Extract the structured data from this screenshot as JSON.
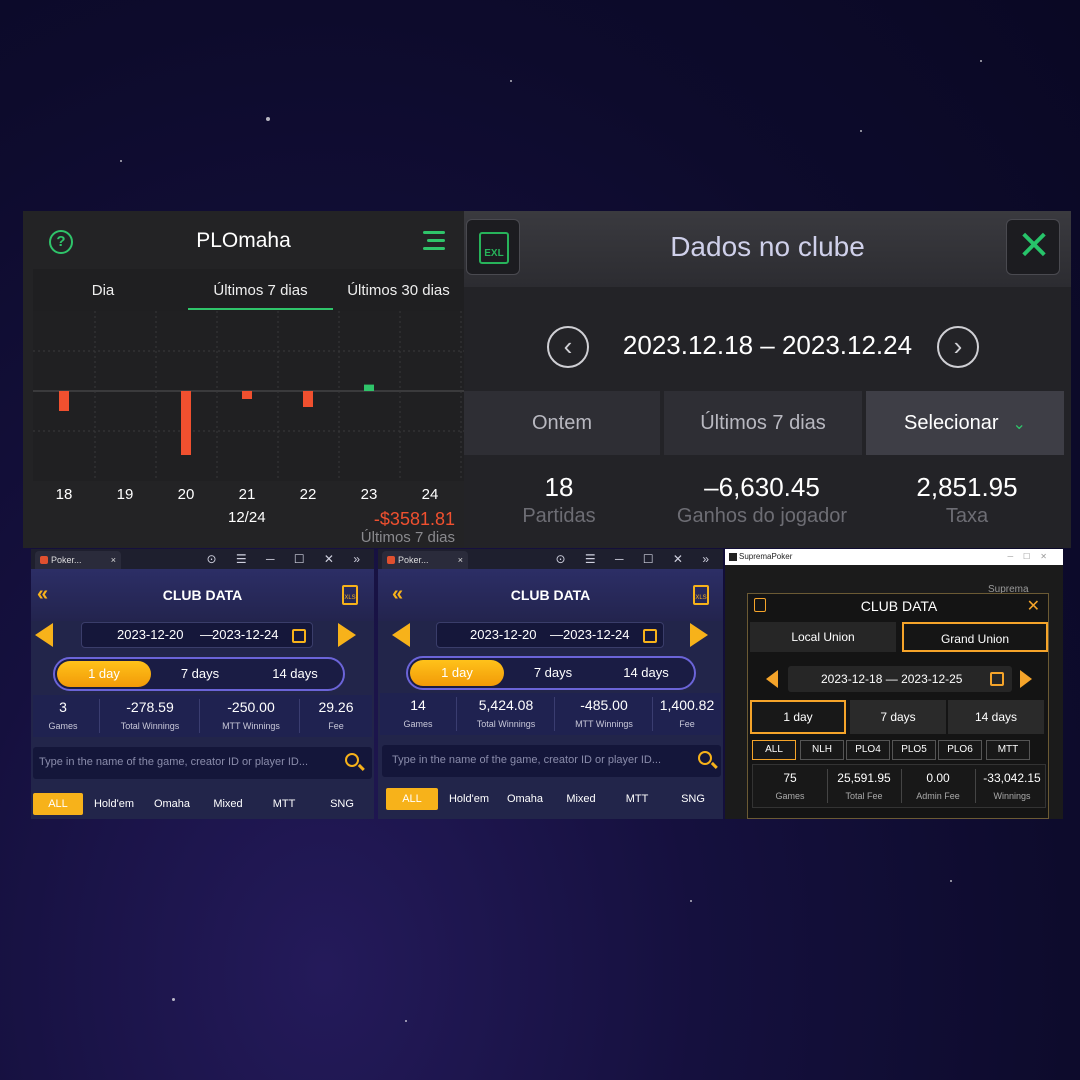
{
  "plomaha": {
    "title": "PLOmaha",
    "tabs": [
      "Dia",
      "Últimos 7 dias",
      "Últimos 30 dias"
    ],
    "selected_tab": "Últimos 7 dias",
    "date": "12/24",
    "total": "-$3581.81",
    "period": "Últimos 7 dias",
    "icons": [
      "help-icon",
      "menu-icon"
    ],
    "accent": "#2fc46a",
    "loss_color": "#f0502f",
    "chart_data": {
      "type": "bar",
      "categories": [
        "18",
        "19",
        "20",
        "21",
        "22",
        "23",
        "24"
      ],
      "values": [
        -2.5,
        0,
        -8,
        -1,
        -2,
        0.8,
        0
      ],
      "ylim": [
        -10,
        10
      ],
      "grid": true
    }
  },
  "dados": {
    "title": "Dados no clube",
    "range": "2023.12.18 – 2023.12.24",
    "tabs": [
      "Ontem",
      "Últimos 7 dias",
      "Selecionar"
    ],
    "selected_tab": "Selecionar",
    "stats": [
      {
        "value": "18",
        "label": "Partidas"
      },
      {
        "value": "–6,630.45",
        "label": "Ganhos do jogador"
      },
      {
        "value": "2,851.95",
        "label": "Taxa"
      }
    ],
    "icons": [
      "excel-icon",
      "close-icon",
      "prev-icon",
      "next-icon"
    ]
  },
  "club1": {
    "window_tab": "Poker...",
    "title": "CLUB DATA",
    "start": "2023-12-20",
    "end": "2023-12-24",
    "periods": [
      "1 day",
      "7 days",
      "14 days"
    ],
    "stats": [
      {
        "value": "3",
        "label": "Games"
      },
      {
        "value": "-278.59",
        "label": "Total Winnings"
      },
      {
        "value": "-250.00",
        "label": "MTT Winnings"
      },
      {
        "value": "29.26",
        "label": "Fee"
      }
    ],
    "search_placeholder": "Type in the name of the game, creator ID or player ID...",
    "filters": [
      "ALL",
      "Hold'em",
      "Omaha",
      "Mixed",
      "MTT",
      "SNG"
    ]
  },
  "club2": {
    "window_tab": "Poker...",
    "title": "CLUB DATA",
    "start": "2023-12-20",
    "end": "2023-12-24",
    "periods": [
      "1 day",
      "7 days",
      "14 days"
    ],
    "stats": [
      {
        "value": "14",
        "label": "Games"
      },
      {
        "value": "5,424.08",
        "label": "Total Winnings"
      },
      {
        "value": "-485.00",
        "label": "MTT Winnings"
      },
      {
        "value": "1,400.82",
        "label": "Fee"
      }
    ],
    "search_placeholder": "Type in the name of the game, creator ID or player ID...",
    "filters": [
      "ALL",
      "Hold'em",
      "Omaha",
      "Mixed",
      "MTT",
      "SNG"
    ]
  },
  "suprema": {
    "window_title": "SupremaPoker",
    "bg_text": "Suprema",
    "title": "CLUB DATA",
    "unions": [
      "Local Union",
      "Grand Union"
    ],
    "start": "2023-12-18",
    "end": "2023-12-25",
    "periods": [
      "1 day",
      "7 days",
      "14 days"
    ],
    "games": [
      "ALL",
      "NLH",
      "PLO4",
      "PLO5",
      "PLO6",
      "MTT"
    ],
    "stats": [
      {
        "value": "75",
        "label": "Games"
      },
      {
        "value": "25,591.95",
        "label": "Total Fee"
      },
      {
        "value": "0.00",
        "label": "Admin Fee"
      },
      {
        "value": "-33,042.15",
        "label": "Winnings"
      }
    ],
    "accent": "#f5a42a"
  }
}
